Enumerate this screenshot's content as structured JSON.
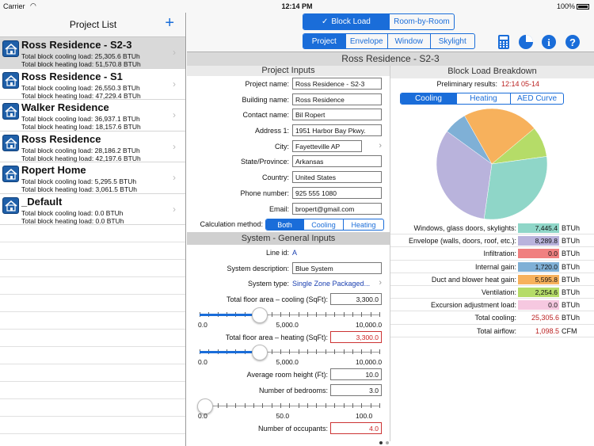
{
  "status": {
    "carrier": "Carrier",
    "time": "12:14 PM",
    "battery": "100%"
  },
  "left": {
    "title": "Project List",
    "projects": [
      {
        "name": "Ross Residence - S2-3",
        "cool": "Total block cooling load: 25,305.6 BTUh",
        "heat": "Total block heating load: 51,570.8 BTUh"
      },
      {
        "name": "Ross Residence - S1",
        "cool": "Total block cooling load: 26,550.3 BTUh",
        "heat": "Total block heating load: 47,229.4 BTUh"
      },
      {
        "name": "Walker Residence",
        "cool": "Total block cooling load: 36,937.1 BTUh",
        "heat": "Total block heating load: 18,157.6 BTUh"
      },
      {
        "name": "Ross Residence",
        "cool": "Total block cooling load: 28,186.2 BTUh",
        "heat": "Total block heating load: 42,197.6 BTUh"
      },
      {
        "name": "Ropert Home",
        "cool": "Total block cooling load: 5,295.5 BTUh",
        "heat": "Total block heating load: 3,061.5 BTUh"
      },
      {
        "name": "_Default",
        "cool": "Total block cooling load: 0.0 BTUh",
        "heat": "Total block heating load: 0.0 BTUh"
      }
    ]
  },
  "top": {
    "mode_tabs": [
      "Block Load",
      "Room-by-Room"
    ],
    "section_tabs": [
      "Project",
      "Envelope",
      "Window",
      "Skylight"
    ],
    "check": "✓"
  },
  "doc_title": "Ross Residence - S2-3",
  "project_inputs": {
    "heading": "Project Inputs",
    "fields": [
      {
        "label": "Project name:",
        "value": "Ross Residence - S2-3"
      },
      {
        "label": "Building name:",
        "value": "Ross Residence"
      },
      {
        "label": "Contact name:",
        "value": "Bil Ropert"
      },
      {
        "label": "Address 1:",
        "value": "1951 Harbor Bay Pkwy."
      },
      {
        "label": "City:",
        "value": "Fayetteville AP"
      },
      {
        "label": "State/Province:",
        "value": "Arkansas"
      },
      {
        "label": "Country:",
        "value": "United States"
      },
      {
        "label": "Phone number:",
        "value": "925 555 1080"
      },
      {
        "label": "Email:",
        "value": "bropert@gmail.com"
      }
    ],
    "calc_label": "Calculation method:",
    "calc_options": [
      "Both",
      "Cooling",
      "Heating"
    ]
  },
  "system": {
    "heading": "System - General Inputs",
    "line_id_label": "Line id:",
    "line_id": "A",
    "desc_label": "System description:",
    "desc": "Blue System",
    "type_label": "System type:",
    "type": "Single Zone Packaged...",
    "cool_area_label": "Total floor area – cooling (SqFt):",
    "cool_area": "3,300.0",
    "heat_area_label": "Total floor area – heating (SqFt):",
    "heat_area": "3,300.0",
    "slider_ticks": [
      "0.0",
      "5,000.0",
      "10,000.0"
    ],
    "room_height_label": "Average room height (Ft):",
    "room_height": "10.0",
    "bedrooms_label": "Number of bedrooms:",
    "bedrooms": "3.0",
    "bed_ticks": [
      "0.0",
      "50.0",
      "100.0"
    ],
    "occupants_label": "Number of occupants:",
    "occupants": "4.0",
    "cool_area_fraction": 0.33,
    "heat_area_fraction": 0.33,
    "bedrooms_fraction": 0.03
  },
  "breakdown": {
    "heading": "Block Load Breakdown",
    "prelim_label": "Preliminary results:",
    "prelim": "12:14 05-14",
    "tabs": [
      "Cooling",
      "Heating",
      "AED Curve"
    ],
    "unit": "BTUh",
    "rows": [
      {
        "label": "Windows, glass doors, skylights:",
        "value": "7,445.4",
        "color": "#8fd6c8"
      },
      {
        "label": "Envelope (walls, doors, roof, etc.):",
        "value": "8,289.8",
        "color": "#b9b3dc"
      },
      {
        "label": "Infiltration:",
        "value": "0.0",
        "color": "#f08080"
      },
      {
        "label": "Internal gain:",
        "value": "1,720.0",
        "color": "#7fb0d6"
      },
      {
        "label": "Duct and blower heat gain:",
        "value": "5,595.8",
        "color": "#f7b15c"
      },
      {
        "label": "Ventilation:",
        "value": "2,254.6",
        "color": "#b5dc68"
      },
      {
        "label": "Excursion adjustment load:",
        "value": "0.0",
        "color": "#f6c8e0"
      }
    ],
    "total_cooling_label": "Total cooling:",
    "total_cooling": "25,305.6",
    "total_airflow_label": "Total airflow:",
    "total_airflow": "1,098.5",
    "airflow_unit": "CFM"
  }
}
